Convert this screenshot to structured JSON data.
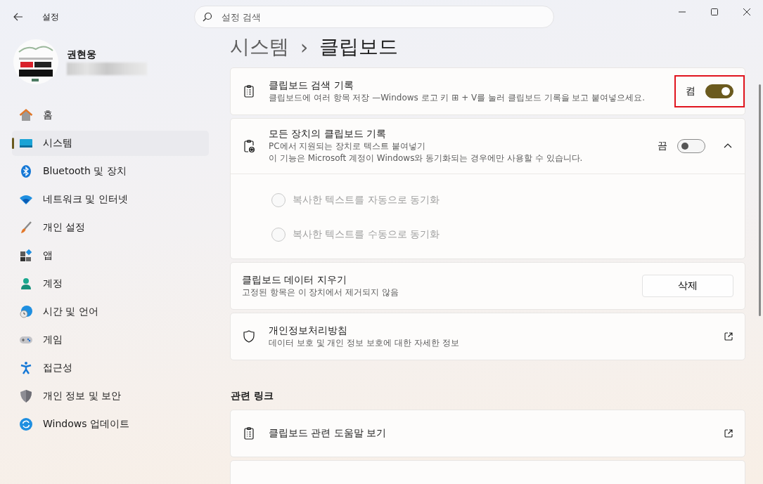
{
  "window": {
    "title": "설정",
    "search_placeholder": "설정 검색"
  },
  "user": {
    "name": "권현웅"
  },
  "sidebar": {
    "items": [
      {
        "label": "홈",
        "selected": false
      },
      {
        "label": "시스템",
        "selected": true
      },
      {
        "label": "Bluetooth 및 장치",
        "selected": false
      },
      {
        "label": "네트워크 및 인터넷",
        "selected": false
      },
      {
        "label": "개인 설정",
        "selected": false
      },
      {
        "label": "앱",
        "selected": false
      },
      {
        "label": "계정",
        "selected": false
      },
      {
        "label": "시간 및 언어",
        "selected": false
      },
      {
        "label": "게임",
        "selected": false
      },
      {
        "label": "접근성",
        "selected": false
      },
      {
        "label": "개인 정보 및 보안",
        "selected": false
      },
      {
        "label": "Windows 업데이트",
        "selected": false
      }
    ]
  },
  "breadcrumb": {
    "parent": "시스템",
    "separator": "›",
    "current": "클립보드"
  },
  "settings": [
    {
      "kind": "toggle",
      "title": "클립보드 검색 기록",
      "description": [
        "클립보드에 여러 항목 저장 —Windows 로고 키 ⊞ + V를 눌러 클립보드 기록을 보고 붙여넣으세요."
      ],
      "state_label": "켬",
      "on": true,
      "highlighted": true
    },
    {
      "kind": "expander",
      "title": "모든 장치의 클립보드 기록",
      "description": [
        "PC에서 지원되는 장치로 텍스트 붙여넣기",
        "이 기능은 Microsoft 계정이 Windows와 동기화되는 경우에만 사용할 수 있습니다."
      ],
      "state_label": "끔",
      "on": false,
      "expanded": true,
      "options": [
        {
          "label": "복사한 텍스트를 자동으로 동기화",
          "selected": false,
          "disabled": true
        },
        {
          "label": "복사한 텍스트를 수동으로 동기화",
          "selected": false,
          "disabled": true
        }
      ]
    },
    {
      "kind": "button",
      "title": "클립보드 데이터 지우기",
      "description": [
        "고정된 항목은 이 장치에서 제거되지 않음"
      ],
      "button": "삭제"
    },
    {
      "kind": "link",
      "title": "개인정보처리방침",
      "description": [
        "데이터 보호 및 개인 정보 보호에 대한 자세한 정보"
      ]
    }
  ],
  "related": {
    "title": "관련 링크",
    "items": [
      {
        "kind": "link",
        "title": "클립보드 관련 도움말 보기"
      },
      {
        "kind": "empty"
      }
    ]
  }
}
